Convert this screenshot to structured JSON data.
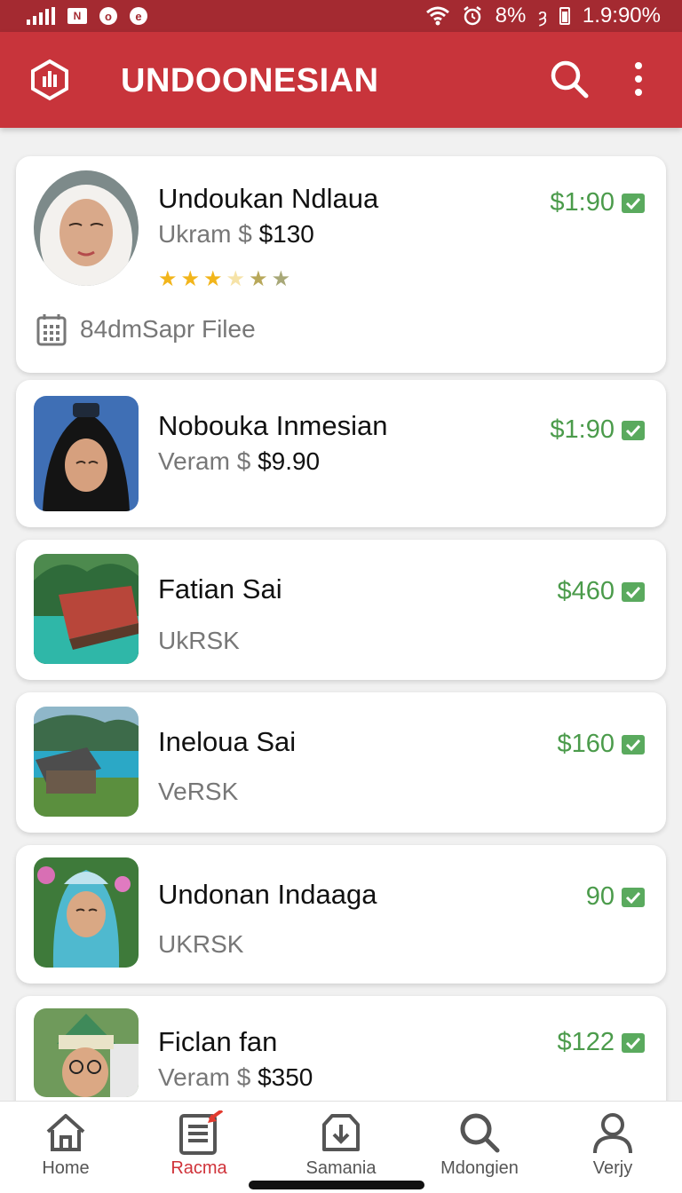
{
  "status_bar": {
    "battery_percent": "8%",
    "time": "1.9:90%"
  },
  "app_bar": {
    "title": "UNDOONESIAN",
    "logo_icon": "hexagon-bars-icon",
    "search_icon": "search-icon",
    "more_icon": "more-vert-icon"
  },
  "listings": [
    {
      "title": "Undoukan Ndlaua",
      "sub_label": "Ukram $",
      "sub_amount": "$130",
      "price": "$1:90",
      "rating": 3.5,
      "footer_text": "84dmSapr Filee",
      "footer_icon": "building-icon",
      "thumb": "portrait-white-hijab"
    },
    {
      "title": "Nobouka Inmesian",
      "sub_label": "Veram $",
      "sub_amount": "$9.90",
      "price": "$1:90",
      "thumb": "portrait-black-hijab"
    },
    {
      "title": "Fatian Sai",
      "sub_label": "UkRSK",
      "sub_amount": "",
      "price": "$460",
      "thumb": "resort-lake"
    },
    {
      "title": "Ineloua Sai",
      "sub_label": "VeRSK",
      "sub_amount": "",
      "price": "$160",
      "thumb": "lake-house"
    },
    {
      "title": "Undonan Indaaga",
      "sub_label": "UKRSK",
      "sub_amount": "",
      "price": "90",
      "thumb": "portrait-blue-hijab"
    },
    {
      "title": "Ficlan fan",
      "sub_label": "Veram $",
      "sub_amount": "$350",
      "price": "$122",
      "thumb": "portrait-glasses-hat"
    }
  ],
  "bottom_nav": [
    {
      "label": "Home",
      "icon": "home-icon",
      "active": false
    },
    {
      "label": "Racma",
      "icon": "list-icon",
      "active": true
    },
    {
      "label": "Samania",
      "icon": "download-icon",
      "active": false
    },
    {
      "label": "Mdongien",
      "icon": "search-icon",
      "active": false
    },
    {
      "label": "Verjy",
      "icon": "user-icon",
      "active": false
    }
  ],
  "colors": {
    "app_bar": "#c8343b",
    "status_bar": "#a42a31",
    "price_green": "#4b9b4b",
    "active_nav": "#d0333a"
  }
}
